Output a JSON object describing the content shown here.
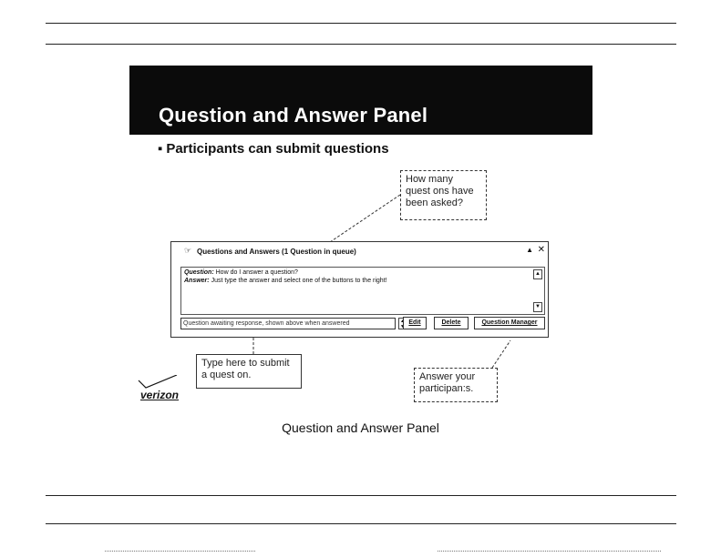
{
  "slide": {
    "title": "Question and Answer Panel",
    "bullet": "Participants can submit questions",
    "bullet_mark": "▪",
    "caption": "Question and Answer Panel",
    "logo_text": "verizon"
  },
  "callouts": {
    "top": [
      "How many",
      "quest ons have",
      "been asked?"
    ],
    "left": [
      "Type here to submit",
      "a quest on."
    ],
    "right": [
      "Answer your",
      "participan:s."
    ]
  },
  "qa_window": {
    "menu_icon": "☞",
    "title": "Questions and Answers (1 Question in queue)",
    "collapse_icon": "▲",
    "close_icon": "✕",
    "question_label": "Question:",
    "question_text": "How do I answer a question?",
    "answer_label": "Answer:",
    "answer_text": "Just type the answer and select one of the buttons to the right!",
    "scroll_up": "▲",
    "scroll_down": "▼",
    "input_value": "Question awaiting response, shown above when answered",
    "edit_label": "Edit",
    "delete_label": "Delete",
    "manager_label": "Question Manager"
  },
  "icons": {
    "menu": "hand-icon",
    "collapse": "collapse-icon",
    "close": "close-icon"
  },
  "colors": {
    "banner": "#0b0b0b",
    "banner_text": "#ffffff"
  }
}
